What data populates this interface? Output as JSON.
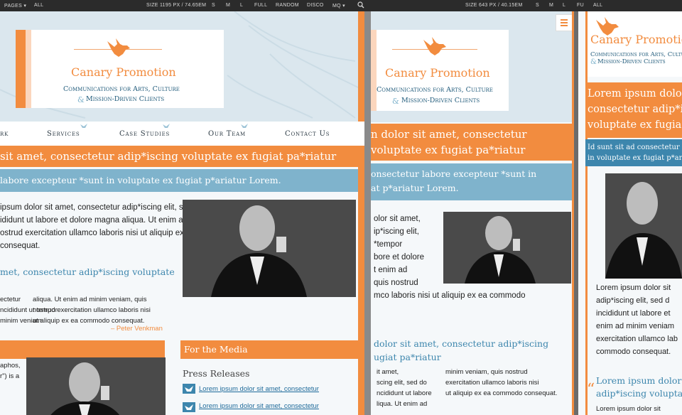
{
  "toolbar": {
    "pages_label": "PAGES ▾",
    "all_label": "ALL",
    "size_left": "SIZE 1195 PX / 74.65EM",
    "size_s": "S",
    "size_m": "M",
    "size_l": "L",
    "full": "FULL",
    "random": "RANDOM",
    "disco": "DISCO",
    "mq": "MQ ▾",
    "size_middle": "SIZE 643 PX / 40.15EM",
    "size_s2": "S",
    "size_m2": "M",
    "size_l2": "L",
    "full2": "FU",
    "all_right": "ALL"
  },
  "site": {
    "brand": "Canary Promotion",
    "tagline_1": "Communications for Arts, Culture",
    "tagline_amp": "&",
    "tagline_2": "Mission-Driven Clients",
    "nav": [
      "rk",
      "Services",
      "Case Studies",
      "Our Team",
      "Contact Us"
    ],
    "menu_icon": "hamburger-menu-icon"
  },
  "pane1": {
    "orange_band": "sit amet, consectetur adip*iscing voluptate ex fugiat pa*riatur",
    "blue_band": "labore excepteur *sunt in voluptate ex fugiat p*ariatur Lorem.",
    "para": [
      "ipsum dolor sit amet, consectetur adip*iscing elit, sed do eiusmod",
      "ididunt ut labore et dolore magna aliqua. Ut enim ad minim",
      "ostrud exercitation ullamco laboris nisi ut aliquip ex ea",
      "consequat."
    ],
    "quote_heading": "met, consectetur adip*iscing voluptate",
    "quote_left": [
      "ectetur",
      "ncididunt ut tempor",
      "minim veniam"
    ],
    "quote_right": [
      "aliqua. Ut enim ad minim veniam, quis",
      "nostrud exercitation ullamco laboris nisi",
      "ut aliquip ex ea commodo consequat."
    ],
    "author": "– Peter Venkman",
    "media_heading": "For the Media",
    "press_heading": "Press Releases",
    "press_links": [
      "Lorem ipsum dolor sit amet, consectetur",
      "Lorem ipsum dolor sit amet, consectetur"
    ],
    "bottom_left": [
      "aphos,",
      "r\") is a"
    ]
  },
  "pane2": {
    "orange_band": [
      "n dolor sit amet, consectetur",
      "voluptate ex fugiat pa*riatur"
    ],
    "blue_band": [
      "onsectetur labore excepteur *sunt in",
      "at p*ariatur Lorem."
    ],
    "para": [
      "olor sit amet,",
      "ip*iscing elit,",
      "*tempor",
      "bore et dolore",
      "t enim ad",
      "quis nostrud",
      "mco laboris nisi ut aliquip ex ea commodo"
    ],
    "quote_heading": [
      "dolor sit amet, consectetur adip*iscing",
      "ugiat pa*riatur"
    ],
    "quote_left": [
      "it amet,",
      "scing elit, sed do",
      "ncididunt ut labore",
      "liqua. Ut enim ad"
    ],
    "quote_right": [
      "minim veniam, quis nostrud",
      "exercitation ullamco laboris nisi",
      "ut aliquip ex ea commodo consequat."
    ]
  },
  "pane3": {
    "orange_band": [
      "Lorem ipsum dolor",
      "consectetur adip*i",
      "voluptate ex fugia"
    ],
    "blue_band": [
      "Id sunt sit ad consectetur",
      "in voluptate ex fugiat p*ar"
    ],
    "para": [
      "Lorem ipsum dolor sit",
      "adip*iscing elit, sed d",
      "incididunt ut labore et",
      "enim ad minim veniam",
      "exercitation ullamco lab",
      "commodo consequat."
    ],
    "quote_heading": [
      "Lorem ipsum dolor s",
      "adip*iscing voluptat"
    ],
    "tail": "Lorem ipsum dolor sit"
  },
  "colors": {
    "accent": "#f28c3f",
    "blue_band": "#7fb3cc",
    "link": "#1e6a9a"
  }
}
